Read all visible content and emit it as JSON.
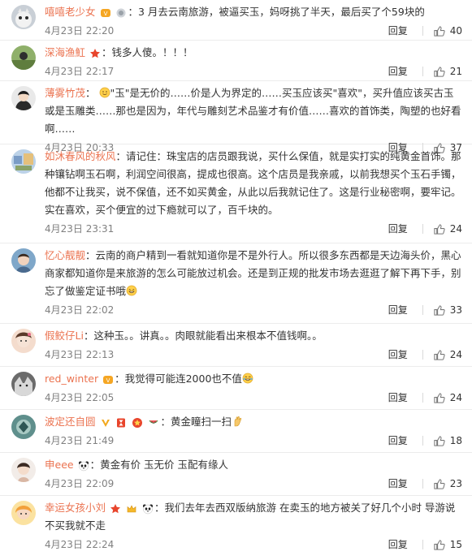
{
  "comments": [
    {
      "user": "嘻嘻老少女",
      "sep": "：",
      "text": "3 月去云南旅游，被逼买玉，妈呀挑了半天，最后买了个59块的",
      "time": "4月23日 22:20",
      "reply": "回复",
      "likes": "40"
    },
    {
      "user": "深海渔魟",
      "sep": "：",
      "text": "钱多人傻。！！！",
      "time": "4月23日 22:17",
      "reply": "回复",
      "likes": "21"
    },
    {
      "user": "薄雾竹茂",
      "sep": "：",
      "text": "\"玉\"是无价的……价是人为界定的……买玉应该买\"喜欢\"，买升值应该买古玉或是玉雕类……那也是因为，年代与雕刻艺术品鉴才有价值……喜欢的首饰类，陶塑的也好看啊……",
      "time": "4月23日 20:33",
      "reply": "回复",
      "likes": "37"
    },
    {
      "user": "如沐春风的秋风",
      "sep": "：",
      "text": "请记住：珠宝店的店员跟我说，买什么保值，就是实打实的纯黄金首饰。那种镶钻啊玉石啊，利润空间很高，提成也很高。这个店员是我亲戚，以前我想买个玉石手镯，他都不让我买，说不保值，还不如买黄金，从此以后我就记住了。这是行业秘密啊，要牢记。实在喜欢，买个便宜的过下瘾就可以了，百千块的。",
      "time": "4月23日 23:31",
      "reply": "回复",
      "likes": "24"
    },
    {
      "user": "忆心靓靓",
      "sep": "：",
      "text": "云南的商户精到一看就知道你是不是外行人。所以很多东西都是天边海头价，黑心商家都知道你是来旅游的怎么可能放过机会。还是到正规的批发市场去逛逛了解下再下手，别忘了做鉴定证书哦",
      "time": "4月23日 22:02",
      "reply": "回复",
      "likes": "33"
    },
    {
      "user": "假鲛仔Li",
      "sep": "：",
      "text": "这种玉。。讲真。。肉眼就能看出来根本不值钱啊。。",
      "time": "4月23日 22:13",
      "reply": "回复",
      "likes": "24"
    },
    {
      "user": "red_winter",
      "sep": "：",
      "text": "我觉得可能连2000也不值",
      "time": "4月23日 22:05",
      "reply": "回复",
      "likes": "24"
    },
    {
      "user": "波定还自圆",
      "sep": "：",
      "text": "黄金瞳扫一扫",
      "time": "4月23日 21:49",
      "reply": "回复",
      "likes": "18"
    },
    {
      "user": "申eee",
      "sep": "：",
      "text": "黄金有价 玉无价 玉配有缘人",
      "time": "4月23日 22:09",
      "reply": "回复",
      "likes": "23"
    },
    {
      "user": "幸运女孩小刘",
      "sep": "：",
      "text": "我们去年去西双版纳旅游 在卖玉的地方被关了好几个小时 导游说不买我就不走",
      "time": "4月23日 22:24",
      "reply": "回复",
      "likes": "15"
    }
  ],
  "colors": {
    "username": "#eb7350",
    "text": "#333333",
    "meta": "#808080"
  }
}
